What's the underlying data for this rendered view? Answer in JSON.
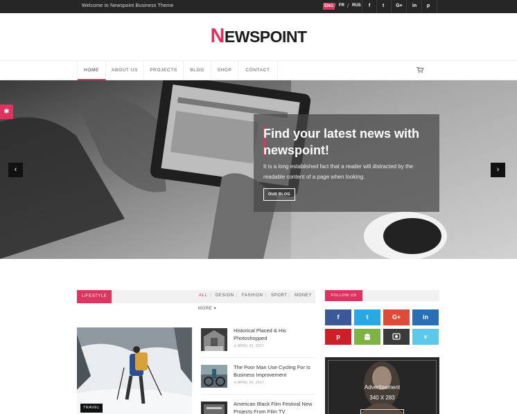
{
  "topbar": {
    "welcome": "Welcome to Newspoint Business Theme",
    "languages": [
      "ENG",
      "FR",
      "RUS"
    ],
    "social": [
      "f",
      "t",
      "G+",
      "in",
      "p"
    ]
  },
  "logo": {
    "first": "N",
    "rest": "EWSPOINT"
  },
  "nav": {
    "items": [
      "HOME",
      "ABOUT US",
      "PROJECTS",
      "BLOG",
      "SHOP",
      "CONTACT"
    ]
  },
  "hero": {
    "title": "Find your latest news with newspoint!",
    "text": "It is a long established fact that a reader will distracted by the readable content of a page when looking.",
    "button": "OUR BLOG",
    "prev": "‹",
    "next": "›"
  },
  "section": {
    "label": "LIFESTYLE",
    "filters": [
      "ALL",
      "DESIGN",
      "FASHION",
      "SPORT",
      "MONEY"
    ],
    "more": "MORE ▾"
  },
  "feature": {
    "tag": "TRAVEL"
  },
  "posts": [
    {
      "title": "Historical Placed & His Photoshopped",
      "date": "APRIL 01, 2017"
    },
    {
      "title": "The Poor Man Use Cycling For Is Business Improvement",
      "date": "APRIL 02, 2017"
    },
    {
      "title": "American Black Film Festival New Projects From Film TV",
      "date": ""
    }
  ],
  "sidebar": {
    "follow_label": "FOLLOW US",
    "social_buttons": [
      "f",
      "t",
      "G+",
      "in",
      "p",
      "android",
      "camera",
      "v"
    ],
    "ad_title": "Advertisement",
    "ad_size": "340 X 283"
  },
  "colors": {
    "accent": "#e0325f",
    "topbar": "#262626"
  }
}
